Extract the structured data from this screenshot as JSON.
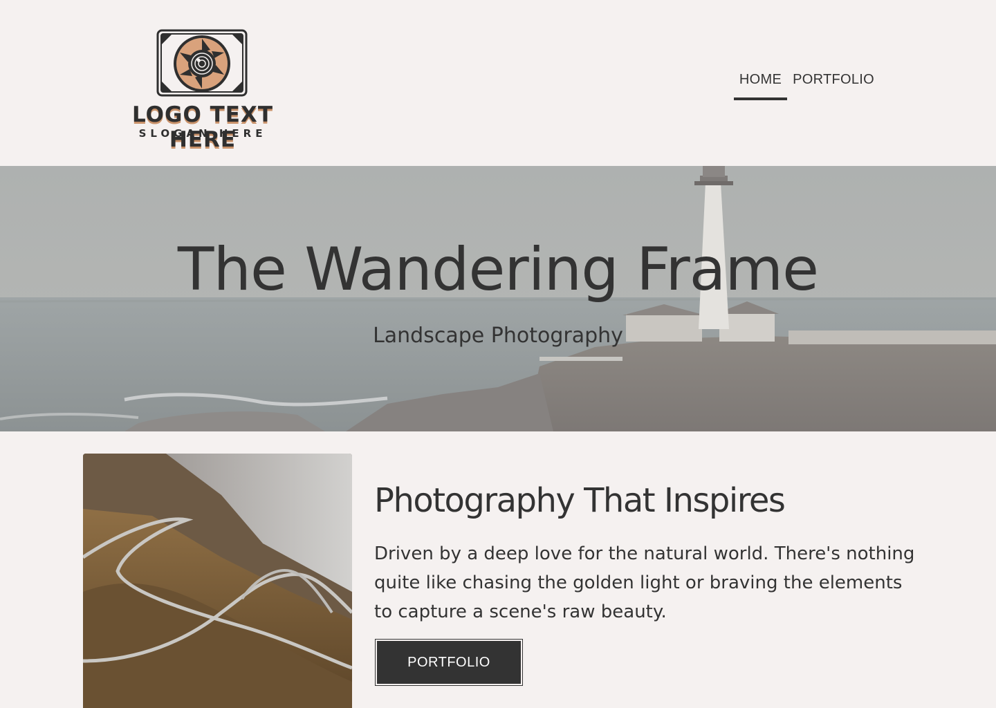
{
  "logo": {
    "text": "LOGO TEXT HERE",
    "slogan": "SLOGAN HERE",
    "icon": "camera-aperture-icon"
  },
  "nav": {
    "items": [
      {
        "label": "HOME",
        "active": true
      },
      {
        "label": "PORTFOLIO",
        "active": false
      }
    ]
  },
  "hero": {
    "title": "The Wandering Frame",
    "subtitle": "Landscape Photography"
  },
  "about": {
    "heading": "Photography That Inspires",
    "body": "Driven by a deep love for the natural world. There's nothing quite like chasing the golden light or braving the elements to capture a scene's raw beauty.",
    "button_label": "PORTFOLIO"
  },
  "colors": {
    "background": "#f5f1f0",
    "text": "#333333",
    "accent": "#c9926a",
    "button": "#333333"
  }
}
